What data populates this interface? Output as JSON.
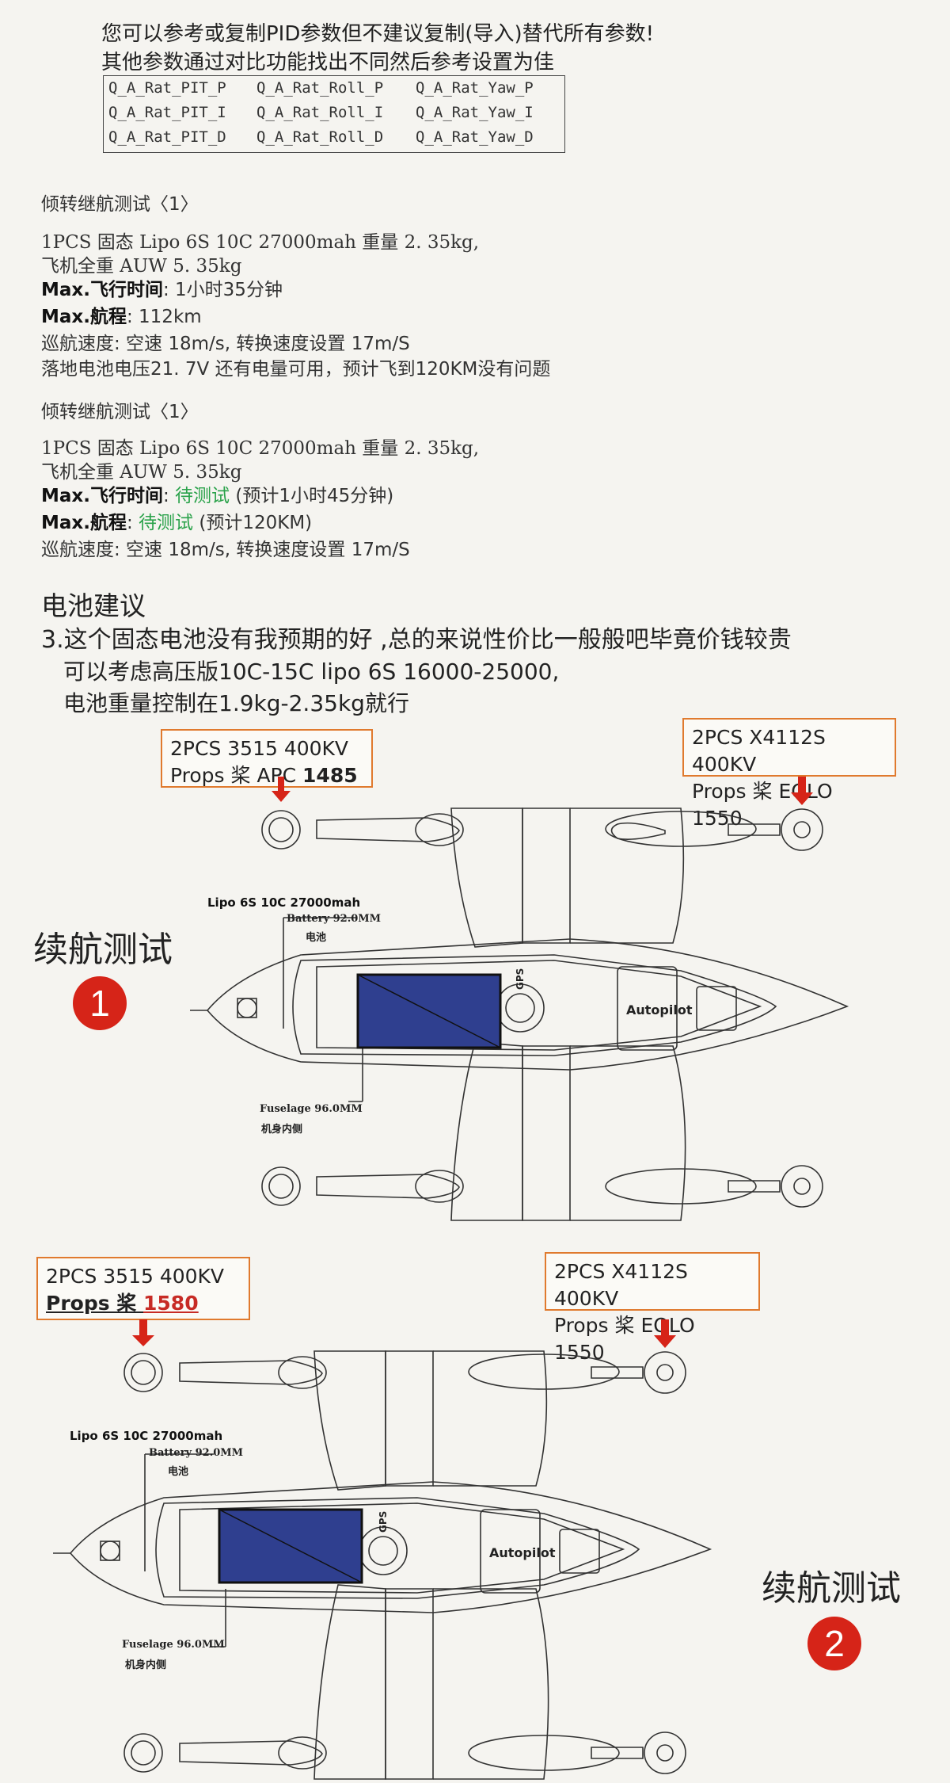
{
  "header": {
    "notice_line1": "您可以参考或复制PID参数但不建议复制(导入)替代所有参数!",
    "notice_line2": "其他参数通过对比功能找出不同然后参考设置为佳"
  },
  "pid_table": {
    "rows": [
      [
        "Q_A_Rat_PIT_P",
        "Q_A_Rat_Roll_P",
        "Q_A_Rat_Yaw_P"
      ],
      [
        "Q_A_Rat_PIT_I",
        "Q_A_Rat_Roll_I",
        "Q_A_Rat_Yaw_I"
      ],
      [
        "Q_A_Rat_PIT_D",
        "Q_A_Rat_Roll_D",
        "Q_A_Rat_Yaw_D"
      ]
    ]
  },
  "test1": {
    "title": "倾转继航测试〈1〉",
    "battery_line": "1PCS 固态 Lipo 6S 10C 27000mah 重量 2. 35kg,",
    "auw_line": "飞机全重 AUW 5. 35kg",
    "flight_time_label": "Max.飞行时间",
    "flight_time_value": ": 1小时35分钟",
    "range_label": "Max.航程",
    "range_value": ": 112km",
    "cruise_line": "巡航速度: 空速 18m/s, 转换速度设置 17m/S",
    "landing_line": "落地电池电压21. 7V 还有电量可用，预计飞到120KM没有问题"
  },
  "test2": {
    "title": "倾转继航测试〈1〉",
    "battery_line": "1PCS 固态 Lipo 6S 10C 27000mah 重量 2. 35kg,",
    "auw_line": "飞机全重 AUW 5. 35kg",
    "flight_time_label": "Max.飞行时间",
    "flight_time_sep": ":",
    "flight_time_status": "待测试",
    "flight_time_note": "(预计1小时45分钟)",
    "range_label": "Max.航程",
    "range_sep": ":",
    "range_status": "待测试",
    "range_note": "(预计120KM)",
    "cruise_line": "巡航速度: 空速 18m/s, 转换速度设置 17m/S"
  },
  "battery_advice": {
    "title": "电池建议",
    "line1": "3.这个固态电池没有我预期的好 ,总的来说性价比一般般吧毕竟价钱较贵",
    "line2": "可以考虑高压版10C-15C lipo 6S 16000-25000,",
    "line3": "电池重量控制在1.9kg-2.35kg就行"
  },
  "diagram1": {
    "callout_left_line1": "2PCS 3515 400KV",
    "callout_left_line2_prefix": "Props 桨 APC ",
    "callout_left_line2_value": "1485",
    "callout_right_line1": "2PCS X4112S 400KV",
    "callout_right_line2": "Props 桨 EOLO 1550",
    "test_label": "续航测试",
    "badge": "1",
    "battery_label": "Lipo 6S 10C 27000mah",
    "battery_dim": "Battery 92.0MM",
    "battery_cn": "电池",
    "fuselage_dim": "Fuselage 96.0MM",
    "fuselage_cn": "机身内侧",
    "autopilot": "Autopilot",
    "gps": "GPS"
  },
  "diagram2": {
    "callout_left_line1": "2PCS 3515 400KV",
    "callout_left_line2_prefix": "Props 桨 ",
    "callout_left_line2_value": "1580",
    "callout_right_line1": "2PCS X4112S 400KV",
    "callout_right_line2": "Props 桨 EOLO 1550",
    "test_label": "续航测试",
    "badge": "2",
    "battery_label": "Lipo 6S 10C 27000mah",
    "battery_dim": "Battery 92.0MM",
    "battery_cn": "电池",
    "fuselage_dim": "Fuselage 96.0MM",
    "fuselage_cn": "机身内侧",
    "autopilot": "Autopilot",
    "gps": "GPS"
  },
  "colors": {
    "callout_border": "#e07a2e",
    "arrow": "#d62418",
    "battery_fill": "#2f3f8f",
    "status_green": "#2aa24a",
    "badge": "#d62418"
  }
}
